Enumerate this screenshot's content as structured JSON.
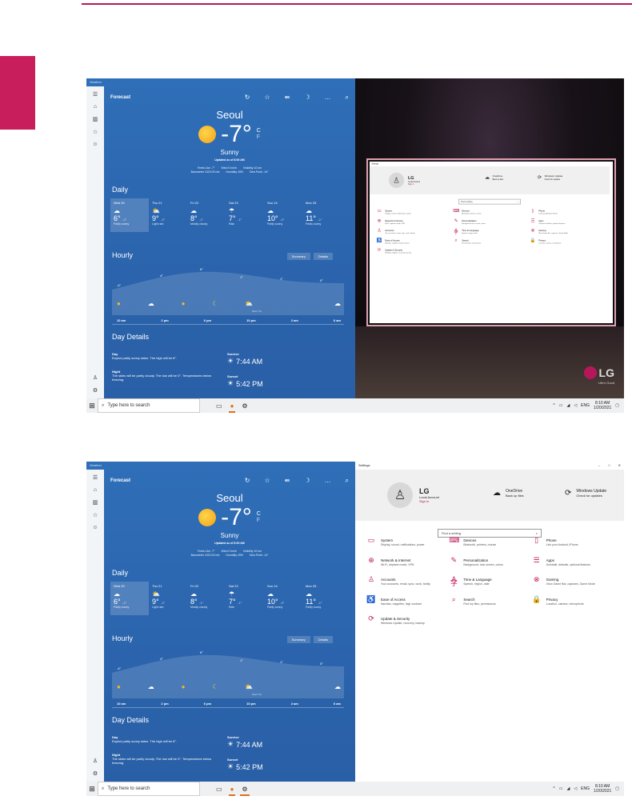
{
  "weather": {
    "window_title": "Weather",
    "header": "Forecast",
    "city": "Seoul",
    "temp": "-7°",
    "unit_c": "C",
    "unit_f": "F",
    "condition": "Sunny",
    "updated": "Updated as of 8:00 AM",
    "facts_line1": [
      "Feels Like  -7°",
      "Wind  0 km/h",
      "Visibility  10 km"
    ],
    "facts_line2": [
      "Barometer  1023.00 mb",
      "Humidity  49%",
      "Dew Point  -14°"
    ],
    "daily_title": "Daily",
    "days": [
      {
        "name": "Wed 20",
        "icon": "☁",
        "hi": "6°",
        "lo": "-2°",
        "desc": "Partly sunny"
      },
      {
        "name": "Thu 21",
        "icon": "⛅",
        "hi": "9°",
        "lo": "-2°",
        "desc": "Light rain"
      },
      {
        "name": "Fri 22",
        "icon": "☁",
        "hi": "8°",
        "lo": "-1°",
        "desc": "Mostly cloudy"
      },
      {
        "name": "Sat 23",
        "icon": "☂",
        "hi": "7°",
        "lo": "-1°",
        "desc": "Rain"
      },
      {
        "name": "Sun 24",
        "icon": "☁",
        "hi": "10°",
        "lo": "-3°",
        "desc": "Partly sunny"
      },
      {
        "name": "Mon 25",
        "icon": "☁",
        "hi": "11°",
        "lo": "-1°",
        "desc": "Partly sunny"
      }
    ],
    "hourly_title": "Hourly",
    "summary_btn": "Summary",
    "details_btn": "Details",
    "graph_labels": [
      "-4°",
      "4°",
      "6°",
      "1°",
      "1°",
      "0°"
    ],
    "hour_icons": [
      "●",
      "☁",
      "●",
      "☾",
      "⛅",
      "",
      "",
      "☁"
    ],
    "hour_times": [
      "10 am",
      "2 pm",
      "6 pm",
      "10 pm",
      "2 am",
      "6 am"
    ],
    "wedthu": "Wed  Thu",
    "details_title": "Day Details",
    "day_label": "Day",
    "day_text": "Expect partly sunny skies. The high will be 6°.",
    "night_label": "Night",
    "night_text": "The skies will be partly cloudy. The low will be 0°. Temperatures below freezing.",
    "sunrise_label": "Sunrise",
    "sunrise": "7:44 AM",
    "sunset_label": "Sunset",
    "sunset": "5:42 PM"
  },
  "taskbar": {
    "search": "Type here to search",
    "lang": "ENG",
    "time": "8:10 AM",
    "date": "1/20/2021"
  },
  "settings": {
    "title": "Settings",
    "user": "LG",
    "account": "Local Account",
    "signin": "Sign in",
    "onedrive": "OneDrive",
    "onedrive_sub": "Back up files",
    "update": "Windows Update",
    "update_sub": "Check for updates",
    "search": "Find a setting",
    "cats": [
      {
        "icon": "▭",
        "title": "System",
        "desc": "Display, sound, notifications, power"
      },
      {
        "icon": "⌨",
        "title": "Devices",
        "desc": "Bluetooth, printers, mouse"
      },
      {
        "icon": "▯",
        "title": "Phone",
        "desc": "Link your Android, iPhone"
      },
      {
        "icon": "⊕",
        "title": "Network & Internet",
        "desc": "Wi-Fi, airplane mode, VPN"
      },
      {
        "icon": "✎",
        "title": "Personalization",
        "desc": "Background, lock screen, colors"
      },
      {
        "icon": "☰",
        "title": "Apps",
        "desc": "Uninstall, defaults, optional features"
      },
      {
        "icon": "♙",
        "title": "Accounts",
        "desc": "Your accounts, email, sync, work, family"
      },
      {
        "icon": "A字",
        "title": "Time & Language",
        "desc": "Speech, region, date"
      },
      {
        "icon": "⊗",
        "title": "Gaming",
        "desc": "Xbox Game Bar, captures, Game Mode"
      },
      {
        "icon": "♿",
        "title": "Ease of Access",
        "desc": "Narrator, magnifier, high contrast"
      },
      {
        "icon": "⌕",
        "title": "Search",
        "desc": "Find my files, permissions"
      },
      {
        "icon": "🔒",
        "title": "Privacy",
        "desc": "Location, camera, microphone"
      },
      {
        "icon": "⟳",
        "title": "Update & Security",
        "desc": "Windows Update, recovery, backup"
      }
    ]
  },
  "logo": {
    "word": "LG",
    "slogan": "Life's Good"
  }
}
